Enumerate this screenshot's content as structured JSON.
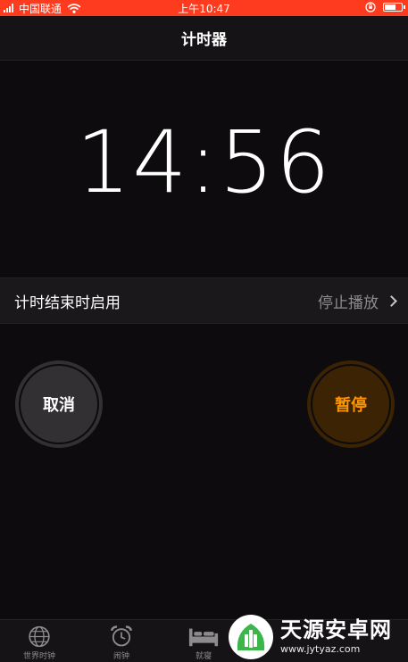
{
  "status_bar": {
    "carrier": "中国联通",
    "time": "上午10:47",
    "battery_level": 0.7
  },
  "nav": {
    "title": "计时器"
  },
  "timer": {
    "display": "14:56"
  },
  "end_action": {
    "label": "计时结束时启用",
    "value": "停止播放"
  },
  "buttons": {
    "cancel": "取消",
    "pause": "暂停"
  },
  "tab_bar": {
    "tabs": [
      {
        "label": "世界时钟",
        "icon": "globe-icon"
      },
      {
        "label": "闹钟",
        "icon": "alarm-clock-icon"
      },
      {
        "label": "就寝",
        "icon": "bed-icon"
      }
    ]
  },
  "watermark": {
    "brand": "天源安卓网",
    "url": "www.jytyaz.com"
  },
  "colors": {
    "status_bar": "#ff3b1f",
    "accent_orange": "#ff9500",
    "background": "#0d0b0d"
  }
}
